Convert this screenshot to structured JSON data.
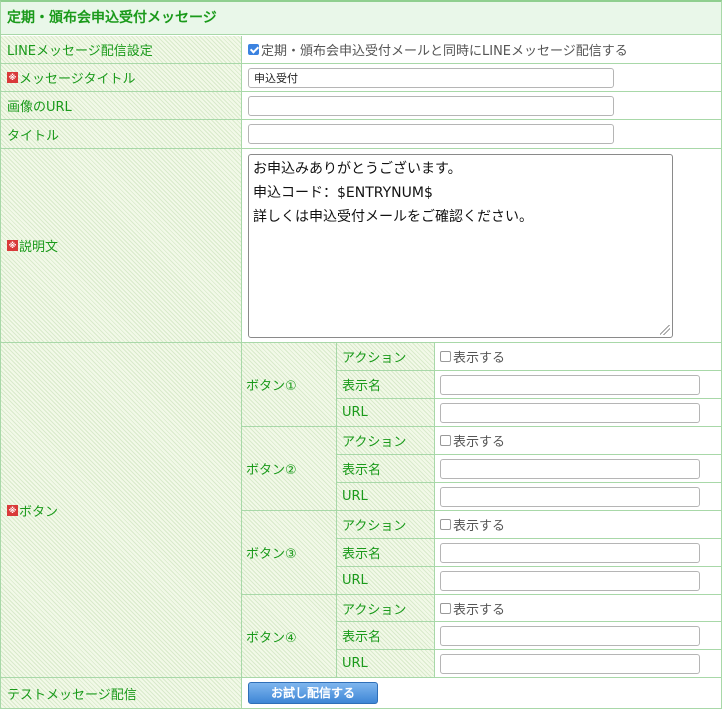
{
  "header": {
    "title": "定期・頒布会申込受付メッセージ"
  },
  "required_mark": "※",
  "line_setting": {
    "label": "LINEメッセージ配信設定",
    "checkbox_label": "定期・頒布会申込受付メールと同時にLINEメッセージ配信する",
    "checked": true
  },
  "message_title": {
    "label": "メッセージタイトル",
    "value": "申込受付"
  },
  "image_url": {
    "label": "画像のURL",
    "value": ""
  },
  "title": {
    "label": "タイトル",
    "value": ""
  },
  "description": {
    "label": "説明文",
    "lines": [
      "お申込みありがとうございます。",
      "申込コード：$ENTRYNUM$",
      "詳しくは申込受付メールをご確認ください。"
    ]
  },
  "buttons": {
    "label": "ボタン",
    "action_label": "アクション",
    "display_name_label": "表示名",
    "url_label": "URL",
    "show_label": "表示する",
    "items": [
      {
        "name": "ボタン①",
        "show": false,
        "display_name": "",
        "url": ""
      },
      {
        "name": "ボタン②",
        "show": false,
        "display_name": "",
        "url": ""
      },
      {
        "name": "ボタン③",
        "show": false,
        "display_name": "",
        "url": ""
      },
      {
        "name": "ボタン④",
        "show": false,
        "display_name": "",
        "url": ""
      }
    ]
  },
  "test_message": {
    "label": "テストメッセージ配信",
    "button_label": "お試し配信する"
  },
  "colors": {
    "label_green": "#1a9a1a",
    "border_green": "#a8d8a8",
    "button_blue": "#3e86d6",
    "required_red": "#d93a3a"
  }
}
